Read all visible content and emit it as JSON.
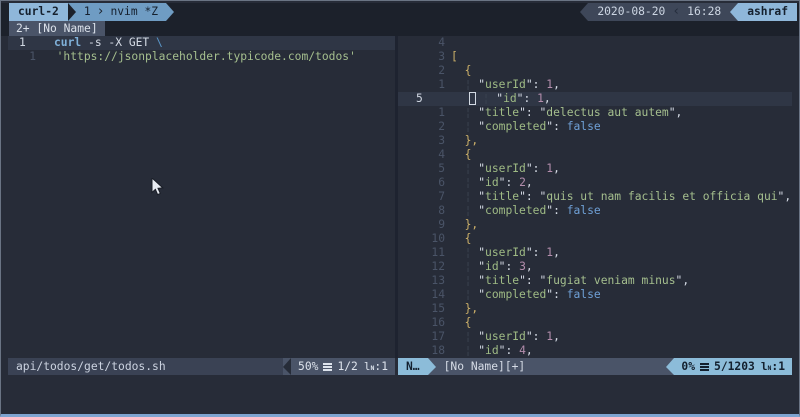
{
  "theme": {
    "background": "#272c38",
    "bar_background": "#1c212b",
    "accent_light_blue": "#8fb7da",
    "accent_mid_blue": "#6f9cc3",
    "statusline_gray": "#4a5468",
    "string_green": "#a5bf8e",
    "number_purple": "#b48ead",
    "bool_blue": "#6fa0d6",
    "brace_yellow": "#cdb169"
  },
  "tmux": {
    "session": "curl-2",
    "window_index": "1",
    "window_name": "nvim *Z",
    "date": "2020-08-20",
    "time": "16:28",
    "user": "ashraf"
  },
  "tabline": {
    "tab": "2+ [No Name]"
  },
  "left_pane": {
    "status": {
      "file": "api/todos/get/todos.sh",
      "percent": "50%",
      "position": "1/2",
      "col": ":1"
    },
    "lines": [
      {
        "num": "1",
        "current": true,
        "tokens": [
          [
            "curl",
            "kw"
          ],
          [
            " -s -X GET ",
            "fg"
          ],
          [
            "\\",
            "esc"
          ]
        ]
      },
      {
        "num": "1",
        "tokens": [
          [
            "  ",
            "fg"
          ],
          [
            "'https://jsonplaceholder.typicode.com/todos'",
            "str"
          ]
        ]
      }
    ]
  },
  "right_pane": {
    "status": {
      "mode": "N…",
      "file": "[No Name][+]",
      "percent": "0%",
      "position": "5/1203",
      "col": ":1"
    },
    "lines": [
      {
        "num": "4",
        "tokens": []
      },
      {
        "num": "3",
        "tokens": [
          [
            "[",
            "br"
          ]
        ]
      },
      {
        "num": "2",
        "tokens": [
          [
            "  ",
            "fg"
          ],
          [
            "{",
            "br"
          ]
        ]
      },
      {
        "num": "1",
        "tokens": [
          [
            "  ",
            "fg"
          ],
          [
            "¦",
            "gd"
          ],
          [
            " ",
            "fg"
          ],
          [
            "\"",
            "fg"
          ],
          [
            "userId",
            "key"
          ],
          [
            "\"",
            "fg"
          ],
          [
            ": ",
            "fg"
          ],
          [
            "1",
            "num"
          ],
          [
            ",",
            "fg"
          ]
        ]
      },
      {
        "num": "5",
        "current": true,
        "tokens": [
          [
            " ",
            "cur"
          ],
          [
            " ",
            "fg"
          ],
          [
            "¦",
            "gd"
          ],
          [
            " ",
            "fg"
          ],
          [
            "\"",
            "fg"
          ],
          [
            "id",
            "key"
          ],
          [
            "\"",
            "fg"
          ],
          [
            ": ",
            "fg"
          ],
          [
            "1",
            "num"
          ],
          [
            ",",
            "fg"
          ]
        ]
      },
      {
        "num": "1",
        "tokens": [
          [
            "  ",
            "fg"
          ],
          [
            "¦",
            "gd"
          ],
          [
            " ",
            "fg"
          ],
          [
            "\"",
            "fg"
          ],
          [
            "title",
            "key"
          ],
          [
            "\"",
            "fg"
          ],
          [
            ": ",
            "fg"
          ],
          [
            "\"",
            "fg"
          ],
          [
            "delectus aut autem",
            "str"
          ],
          [
            "\"",
            "fg"
          ],
          [
            ",",
            "fg"
          ]
        ]
      },
      {
        "num": "2",
        "tokens": [
          [
            "  ",
            "fg"
          ],
          [
            "¦",
            "gd"
          ],
          [
            " ",
            "fg"
          ],
          [
            "\"",
            "fg"
          ],
          [
            "completed",
            "key"
          ],
          [
            "\"",
            "fg"
          ],
          [
            ": ",
            "fg"
          ],
          [
            "false",
            "bool"
          ]
        ]
      },
      {
        "num": "3",
        "tokens": [
          [
            "  ",
            "fg"
          ],
          [
            "},",
            "br"
          ]
        ]
      },
      {
        "num": "4",
        "tokens": [
          [
            "  ",
            "fg"
          ],
          [
            "{",
            "br"
          ]
        ]
      },
      {
        "num": "5",
        "tokens": [
          [
            "  ",
            "fg"
          ],
          [
            "¦",
            "gd"
          ],
          [
            " ",
            "fg"
          ],
          [
            "\"",
            "fg"
          ],
          [
            "userId",
            "key"
          ],
          [
            "\"",
            "fg"
          ],
          [
            ": ",
            "fg"
          ],
          [
            "1",
            "num"
          ],
          [
            ",",
            "fg"
          ]
        ]
      },
      {
        "num": "6",
        "tokens": [
          [
            "  ",
            "fg"
          ],
          [
            "¦",
            "gd"
          ],
          [
            " ",
            "fg"
          ],
          [
            "\"",
            "fg"
          ],
          [
            "id",
            "key"
          ],
          [
            "\"",
            "fg"
          ],
          [
            ": ",
            "fg"
          ],
          [
            "2",
            "num"
          ],
          [
            ",",
            "fg"
          ]
        ]
      },
      {
        "num": "7",
        "tokens": [
          [
            "  ",
            "fg"
          ],
          [
            "¦",
            "gd"
          ],
          [
            " ",
            "fg"
          ],
          [
            "\"",
            "fg"
          ],
          [
            "title",
            "key"
          ],
          [
            "\"",
            "fg"
          ],
          [
            ": ",
            "fg"
          ],
          [
            "\"",
            "fg"
          ],
          [
            "quis ut nam facilis et officia qui",
            "str"
          ],
          [
            "\"",
            "fg"
          ],
          [
            ",",
            "fg"
          ]
        ]
      },
      {
        "num": "8",
        "tokens": [
          [
            "  ",
            "fg"
          ],
          [
            "¦",
            "gd"
          ],
          [
            " ",
            "fg"
          ],
          [
            "\"",
            "fg"
          ],
          [
            "completed",
            "key"
          ],
          [
            "\"",
            "fg"
          ],
          [
            ": ",
            "fg"
          ],
          [
            "false",
            "bool"
          ]
        ]
      },
      {
        "num": "9",
        "tokens": [
          [
            "  ",
            "fg"
          ],
          [
            "},",
            "br"
          ]
        ]
      },
      {
        "num": "10",
        "tokens": [
          [
            "  ",
            "fg"
          ],
          [
            "{",
            "br"
          ]
        ]
      },
      {
        "num": "11",
        "tokens": [
          [
            "  ",
            "fg"
          ],
          [
            "¦",
            "gd"
          ],
          [
            " ",
            "fg"
          ],
          [
            "\"",
            "fg"
          ],
          [
            "userId",
            "key"
          ],
          [
            "\"",
            "fg"
          ],
          [
            ": ",
            "fg"
          ],
          [
            "1",
            "num"
          ],
          [
            ",",
            "fg"
          ]
        ]
      },
      {
        "num": "12",
        "tokens": [
          [
            "  ",
            "fg"
          ],
          [
            "¦",
            "gd"
          ],
          [
            " ",
            "fg"
          ],
          [
            "\"",
            "fg"
          ],
          [
            "id",
            "key"
          ],
          [
            "\"",
            "fg"
          ],
          [
            ": ",
            "fg"
          ],
          [
            "3",
            "num"
          ],
          [
            ",",
            "fg"
          ]
        ]
      },
      {
        "num": "13",
        "tokens": [
          [
            "  ",
            "fg"
          ],
          [
            "¦",
            "gd"
          ],
          [
            " ",
            "fg"
          ],
          [
            "\"",
            "fg"
          ],
          [
            "title",
            "key"
          ],
          [
            "\"",
            "fg"
          ],
          [
            ": ",
            "fg"
          ],
          [
            "\"",
            "fg"
          ],
          [
            "fugiat veniam minus",
            "str"
          ],
          [
            "\"",
            "fg"
          ],
          [
            ",",
            "fg"
          ]
        ]
      },
      {
        "num": "14",
        "tokens": [
          [
            "  ",
            "fg"
          ],
          [
            "¦",
            "gd"
          ],
          [
            " ",
            "fg"
          ],
          [
            "\"",
            "fg"
          ],
          [
            "completed",
            "key"
          ],
          [
            "\"",
            "fg"
          ],
          [
            ": ",
            "fg"
          ],
          [
            "false",
            "bool"
          ]
        ]
      },
      {
        "num": "15",
        "tokens": [
          [
            "  ",
            "fg"
          ],
          [
            "},",
            "br"
          ]
        ]
      },
      {
        "num": "16",
        "tokens": [
          [
            "  ",
            "fg"
          ],
          [
            "{",
            "br"
          ]
        ]
      },
      {
        "num": "17",
        "tokens": [
          [
            "  ",
            "fg"
          ],
          [
            "¦",
            "gd"
          ],
          [
            " ",
            "fg"
          ],
          [
            "\"",
            "fg"
          ],
          [
            "userId",
            "key"
          ],
          [
            "\"",
            "fg"
          ],
          [
            ": ",
            "fg"
          ],
          [
            "1",
            "num"
          ],
          [
            ",",
            "fg"
          ]
        ]
      },
      {
        "num": "18",
        "tokens": [
          [
            "  ",
            "fg"
          ],
          [
            "¦",
            "gd"
          ],
          [
            " ",
            "fg"
          ],
          [
            "\"",
            "fg"
          ],
          [
            "id",
            "key"
          ],
          [
            "\"",
            "fg"
          ],
          [
            ": ",
            "fg"
          ],
          [
            "4",
            "num"
          ],
          [
            ",",
            "fg"
          ]
        ]
      }
    ]
  }
}
